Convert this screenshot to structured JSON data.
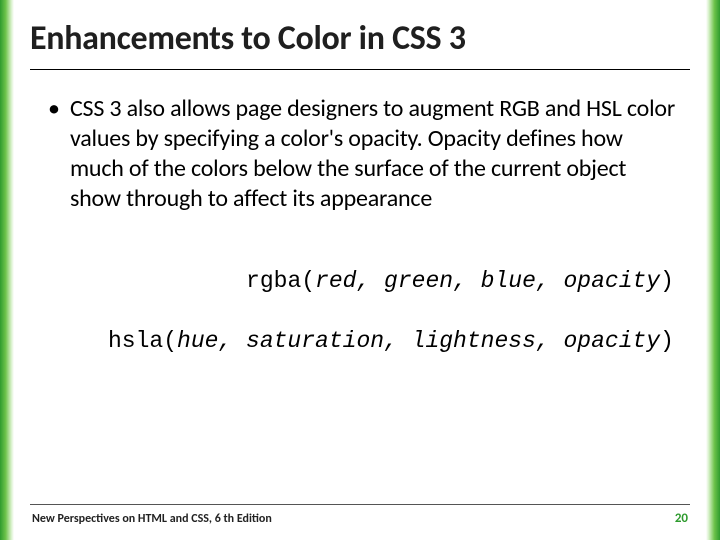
{
  "title": "Enhancements to Color in CSS 3",
  "bullet_text": "CSS 3 also allows page designers to augment RGB and HSL color values by specifying a color's opacity. Opacity defines how much of the colors below the surface of the current object show through to affect its appearance",
  "code": {
    "line1_fn": "rgba(",
    "line1_args": "red, green, blue, opacity",
    "line1_close": ")",
    "line2_fn": "hsla(",
    "line2_args": "hue, saturation, lightness, opacity",
    "line2_close": ")"
  },
  "footer": {
    "book": "New Perspectives on HTML and CSS, 6 th Edition",
    "page": "20"
  },
  "colors": {
    "accent_green": "#2e9b2e"
  }
}
